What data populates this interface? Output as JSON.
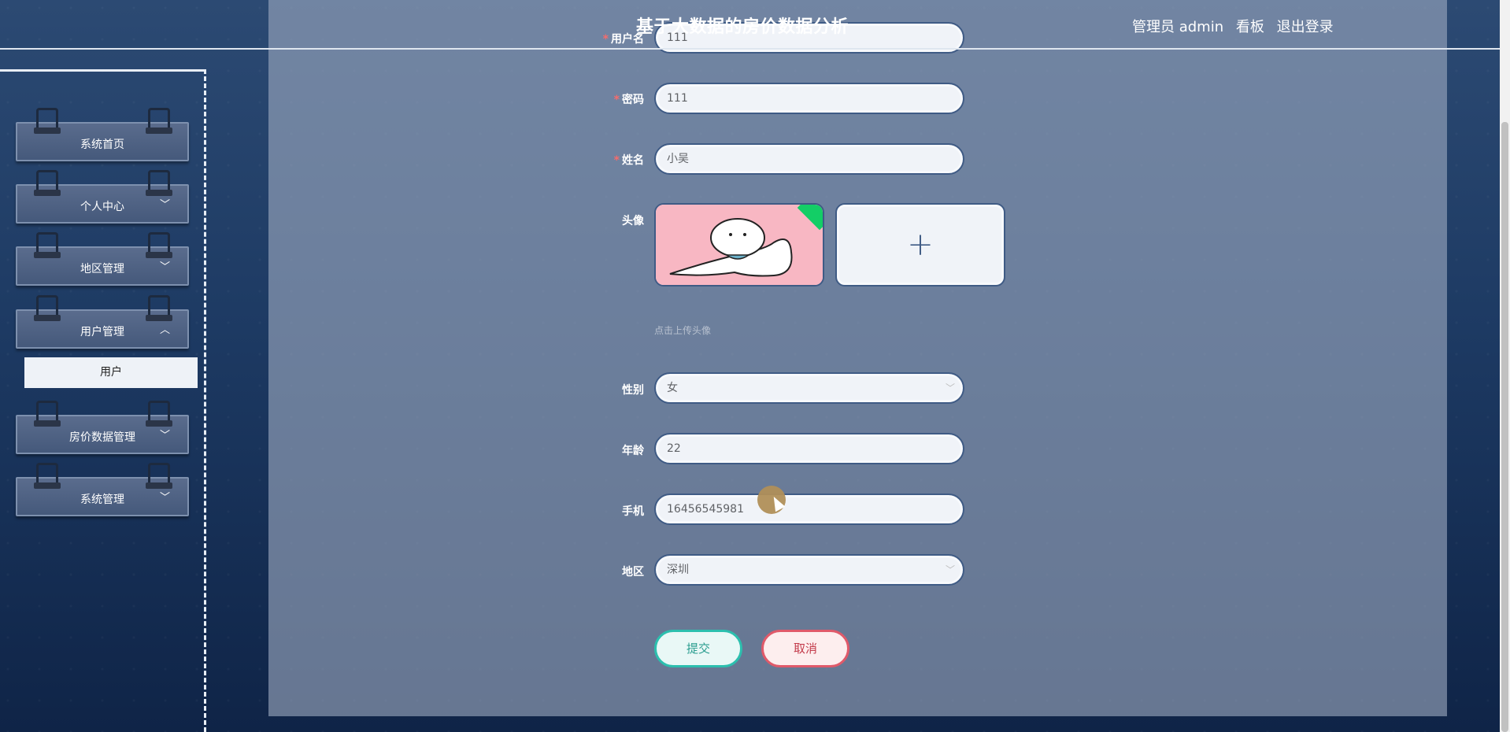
{
  "header": {
    "title": "基于大数据的房价数据分析",
    "user_label": "管理员 admin",
    "dashboard_label": "看板",
    "logout_label": "退出登录"
  },
  "sidebar": {
    "items": [
      {
        "label": "系统首页",
        "has_chevron": false
      },
      {
        "label": "个人中心",
        "chevron": "﹀"
      },
      {
        "label": "地区管理",
        "chevron": "﹀"
      },
      {
        "label": "用户管理",
        "chevron": "︿"
      },
      {
        "label": "房价数据管理",
        "chevron": "﹀"
      },
      {
        "label": "系统管理",
        "chevron": "﹀"
      }
    ],
    "submenu_active": "用户"
  },
  "form": {
    "username": {
      "label": "用户名",
      "required": "*",
      "value": "111"
    },
    "password": {
      "label": "密码",
      "required": "*",
      "value": "111"
    },
    "name": {
      "label": "姓名",
      "required": "*",
      "value": "小吴"
    },
    "avatar": {
      "label": "头像",
      "hint": "点击上传头像",
      "add_icon": "+"
    },
    "gender": {
      "label": "性别",
      "value": "女"
    },
    "age": {
      "label": "年龄",
      "value": "22"
    },
    "phone": {
      "label": "手机",
      "value": "16456545981"
    },
    "region": {
      "label": "地区",
      "value": "深圳"
    },
    "submit_label": "提交",
    "cancel_label": "取消"
  },
  "colors": {
    "accent_submit": "#2cbfae",
    "accent_cancel": "#e05a6a",
    "required": "#f56c6c"
  }
}
